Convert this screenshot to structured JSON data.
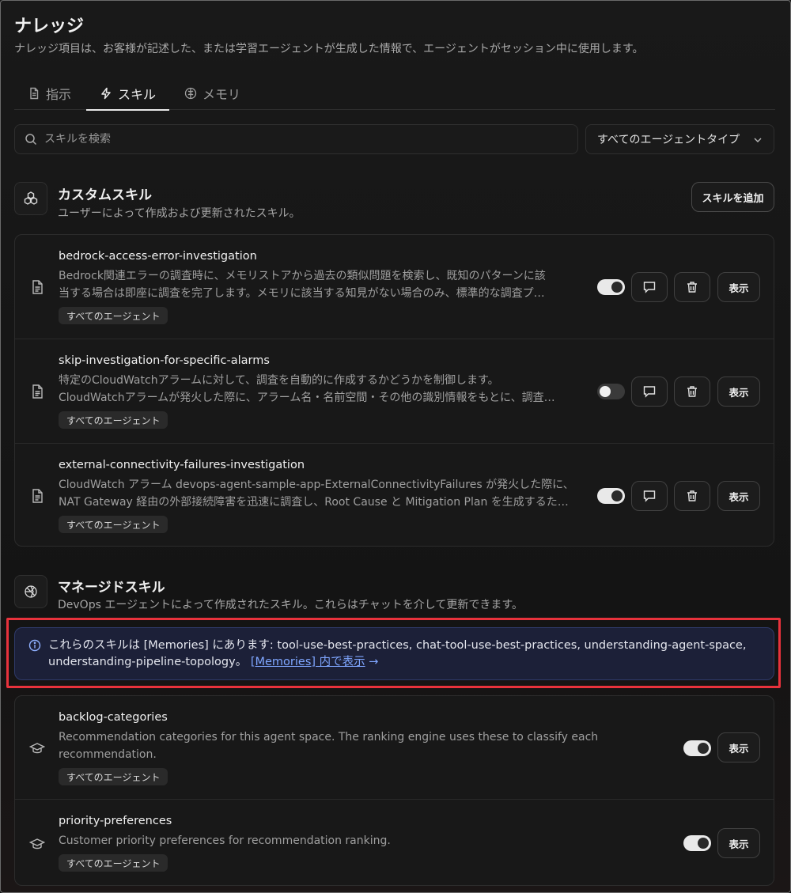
{
  "page": {
    "title": "ナレッジ",
    "description": "ナレッジ項目は、お客様が記述した、または学習エージェントが生成した情報で、エージェントがセッション中に使用します。"
  },
  "tabs": [
    {
      "label": "指示",
      "icon": "document-icon",
      "active": false
    },
    {
      "label": "スキル",
      "icon": "lightning-icon",
      "active": true
    },
    {
      "label": "メモリ",
      "icon": "brain-icon",
      "active": false
    }
  ],
  "search": {
    "placeholder": "スキルを検索",
    "value": ""
  },
  "filter": {
    "selected": "すべてのエージェントタイプ"
  },
  "custom": {
    "title": "カスタムスキル",
    "description": "ユーザーによって作成および更新されたスキル。",
    "add_label": "スキルを追加",
    "items": [
      {
        "name": "bedrock-access-error-investigation",
        "desc1": "Bedrock関連エラーの調査時に、メモリストアから過去の類似問題を検索し、既知のパターンに該",
        "desc2": "当する場合は即座に調査を完了します。メモリに該当する知見がない場合のみ、標準的な調査プ…",
        "badge": "すべてのエージェント",
        "enabled": true,
        "view_label": "表示"
      },
      {
        "name": "skip-investigation-for-specific-alarms",
        "desc1": "特定のCloudWatchアラームに対して、調査を自動的に作成するかどうかを制御します。",
        "desc2": "CloudWatchアラームが発火した際に、アラーム名・名前空間・その他の識別情報をもとに、調査…",
        "badge": "すべてのエージェント",
        "enabled": false,
        "view_label": "表示"
      },
      {
        "name": "external-connectivity-failures-investigation",
        "desc1": "CloudWatch アラーム devops-agent-sample-app-ExternalConnectivityFailures が発火した際に、",
        "desc2": "NAT Gateway 経由の外部接続障害を迅速に調査し、Root Cause と Mitigation Plan を生成するた…",
        "badge": "すべてのエージェント",
        "enabled": true,
        "view_label": "表示"
      }
    ]
  },
  "managed": {
    "title": "マネージドスキル",
    "description": "DevOps エージェントによって作成されたスキル。これらはチャットを介して更新できます。",
    "info_line1": "これらのスキルは [Memories] にあります: tool-use-best-practices, chat-tool-use-best-practices, understanding-agent-space,",
    "info_line2": "understanding-pipeline-topology。",
    "info_link": "[Memories] 内で表示",
    "info_arrow": "→",
    "items": [
      {
        "name": "backlog-categories",
        "desc1": "Recommendation categories for this agent space. The ranking engine uses these to classify each",
        "desc2": "recommendation.",
        "badge": "すべてのエージェント",
        "enabled": true,
        "view_label": "表示"
      },
      {
        "name": "priority-preferences",
        "desc1": "Customer priority preferences for recommendation ranking.",
        "badge": "すべてのエージェント",
        "enabled": true,
        "view_label": "表示"
      }
    ]
  },
  "colors": {
    "accent_link": "#7fa6ff",
    "highlight_border": "#e8323c",
    "info_bg": "#1c2038"
  }
}
